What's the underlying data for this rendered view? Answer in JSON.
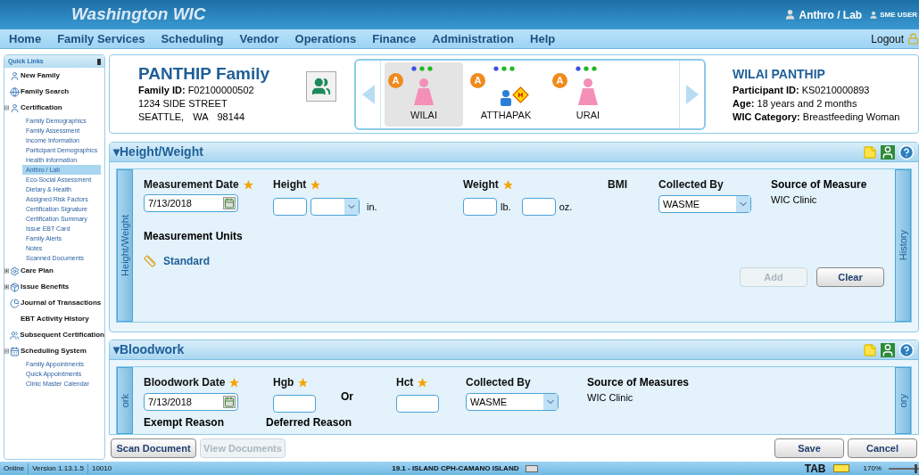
{
  "app": {
    "title": "Washington WIC",
    "role": "Anthro / Lab",
    "user": "SME USER",
    "logout": "Logout"
  },
  "menu": [
    {
      "label": "Home"
    },
    {
      "label": "Family Services"
    },
    {
      "label": "Scheduling"
    },
    {
      "label": "Vendor"
    },
    {
      "label": "Operations"
    },
    {
      "label": "Finance"
    },
    {
      "label": "Administration"
    },
    {
      "label": "Help"
    }
  ],
  "quick_links": {
    "title": "Quick Links",
    "items": [
      {
        "label": "New Family",
        "kind": "user"
      },
      {
        "label": "Family Search",
        "kind": "globe"
      },
      {
        "label": "Certification",
        "kind": "user-up",
        "expanded": true,
        "children": [
          {
            "label": "Family Demographics",
            "selected": false
          },
          {
            "label": "Family Assessment",
            "selected": false
          },
          {
            "label": "Income Information",
            "selected": false
          },
          {
            "label": "Participant Demographics",
            "selected": false
          },
          {
            "label": "Health Information",
            "selected": false
          },
          {
            "label": "Anthro / Lab",
            "selected": true
          },
          {
            "label": "Eco-Social Assessment",
            "selected": false
          },
          {
            "label": "Dietary & Health",
            "selected": false
          },
          {
            "label": "Assigned Risk Factors",
            "selected": false
          },
          {
            "label": "Certification Signature",
            "selected": false
          },
          {
            "label": "Certification Summary",
            "selected": false
          },
          {
            "label": "Issue EBT Card",
            "selected": false
          },
          {
            "label": "Family Alerts",
            "selected": false
          },
          {
            "label": "Notes",
            "selected": false
          },
          {
            "label": "Scanned Documents",
            "selected": false
          }
        ]
      },
      {
        "label": "Care Plan",
        "kind": "gears",
        "expanded": false
      },
      {
        "label": "Issue Benefits",
        "kind": "box",
        "expanded": false
      },
      {
        "label": "Journal of Transactions",
        "kind": "pie"
      },
      {
        "label": "EBT Activity History",
        "kind": "plain"
      },
      {
        "label": "Subsequent Certification",
        "kind": "people"
      },
      {
        "label": "Scheduling System",
        "kind": "calendar",
        "expanded": true,
        "children": [
          {
            "label": "Family Appointments",
            "selected": false
          },
          {
            "label": "Quick Appointments",
            "selected": false
          },
          {
            "label": "Clinic Master Calendar",
            "selected": false
          }
        ]
      }
    ]
  },
  "family": {
    "name": "PANTHIP Family",
    "id_label": "Family ID:",
    "id": "F02100000502",
    "street": "1234 SIDE STREET",
    "city": "SEATTLE,",
    "state": "WA",
    "zip": "98144"
  },
  "participants": [
    {
      "name": "WILAI",
      "kind": "woman",
      "selected": true,
      "badges": [
        "A"
      ]
    },
    {
      "name": "ATTHAPAK",
      "kind": "child",
      "selected": false,
      "badges": [
        "A"
      ],
      "flags": [
        "H"
      ]
    },
    {
      "name": "URAI",
      "kind": "woman",
      "selected": false,
      "badges": [
        "A"
      ]
    }
  ],
  "participant": {
    "name": "WILAI PANTHIP",
    "rows": [
      {
        "label": "Participant ID:",
        "value": "KS0210000893"
      },
      {
        "label": "Age:",
        "value": "18 years and 2 months"
      },
      {
        "label": "WIC Category:",
        "value": "Breastfeeding Woman"
      }
    ]
  },
  "height_weight": {
    "toggle": "▾",
    "title": "Height/Weight",
    "side_tab": "Height/Weight",
    "history_tab": "History",
    "date": {
      "label": "Measurement Date",
      "required": true,
      "value": "7/13/2018"
    },
    "height": {
      "label": "Height",
      "required": true,
      "unit": "in."
    },
    "weight": {
      "label": "Weight",
      "required": true,
      "unit_lb": "lb.",
      "unit_oz": "oz."
    },
    "bmi": {
      "label": "BMI",
      "required": false
    },
    "collected_by": {
      "label": "Collected By",
      "required": false,
      "value": "WASME"
    },
    "source": {
      "label": "Source of Measure",
      "value": "WIC Clinic"
    },
    "units": {
      "label": "Measurement Units",
      "value": "Standard"
    },
    "buttons": [
      {
        "label": "Add",
        "disabled": true
      },
      {
        "label": "Clear",
        "disabled": false
      }
    ]
  },
  "bloodwork": {
    "toggle": "▾",
    "title": "Bloodwork",
    "side_tab": "ork",
    "history_tab": "ory",
    "date": {
      "label": "Bloodwork Date",
      "required": true,
      "value": "7/13/2018"
    },
    "hgb": {
      "label": "Hgb",
      "required": true
    },
    "or": "Or",
    "hct": {
      "label": "Hct",
      "required": true
    },
    "collected_by": {
      "label": "Collected By",
      "required": false,
      "value": "WASME"
    },
    "source": {
      "label": "Source of Measures",
      "value": "WIC Clinic"
    },
    "exempt": "Exempt Reason",
    "deferred": "Deferred Reason"
  },
  "footer": {
    "left": [
      {
        "label": "Scan Document",
        "disabled": false
      },
      {
        "label": "View Documents",
        "disabled": true
      }
    ],
    "right": [
      {
        "label": "Save",
        "disabled": false
      },
      {
        "label": "Cancel",
        "disabled": false
      }
    ]
  },
  "status_bar": {
    "mode": "Online",
    "version": "Version 1.13.1.5",
    "code": "10010",
    "location": "19.1 - ISLAND CPH-CAMANO ISLAND",
    "tab": "TAB",
    "zoom": "170%",
    "zoom_slider": {
      "level": 0.95
    }
  }
}
